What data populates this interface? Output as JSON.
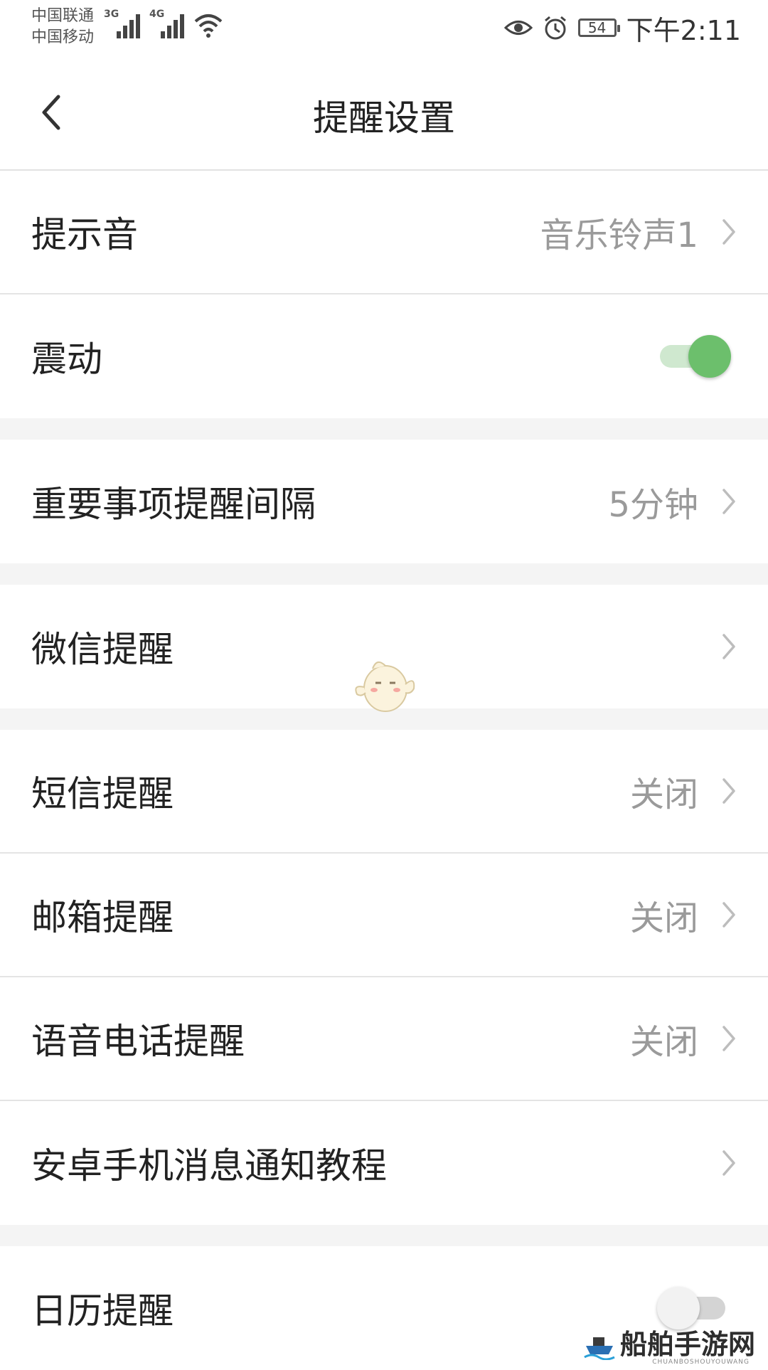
{
  "status_bar": {
    "carrier_1": "中国联通",
    "carrier_2": "中国移动",
    "net_1": "3G",
    "net_2": "4G",
    "battery": "54",
    "time": "下午2:11"
  },
  "header": {
    "title": "提醒设置",
    "back_icon": "chevron-left-icon"
  },
  "settings": {
    "sound": {
      "label": "提示音",
      "value": "音乐铃声1"
    },
    "vibrate": {
      "label": "震动",
      "enabled": true
    },
    "important_interval": {
      "label": "重要事项提醒间隔",
      "value": "5分钟"
    },
    "wechat": {
      "label": "微信提醒"
    },
    "sms": {
      "label": "短信提醒",
      "value": "关闭"
    },
    "email": {
      "label": "邮箱提醒",
      "value": "关闭"
    },
    "voice_call": {
      "label": "语音电话提醒",
      "value": "关闭"
    },
    "android_tutorial": {
      "label": "安卓手机消息通知教程"
    },
    "calendar": {
      "label": "日历提醒",
      "enabled": false
    }
  },
  "colors": {
    "toggle_on": "#6cbf6c",
    "toggle_on_track": "#cfe8cf",
    "toggle_off": "#f2f2f2",
    "value_text": "#9a9a9a",
    "divider": "#e4e4e4",
    "section_gap": "#f4f4f4"
  },
  "watermark": {
    "text": "船舶手游网",
    "sub": "CHUANBOSHOUYOUWANG"
  }
}
